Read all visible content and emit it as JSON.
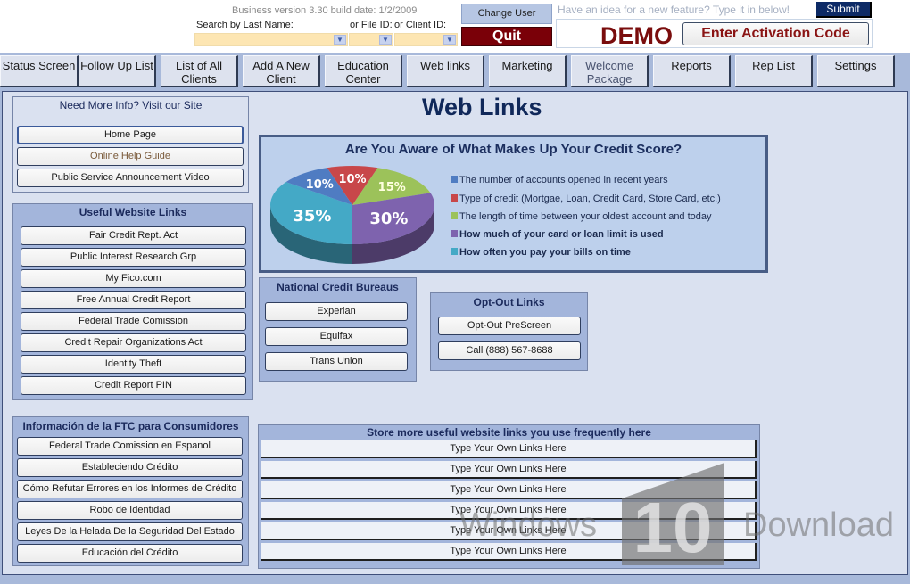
{
  "header": {
    "version_text": "Business version 3.30  build date: 1/2/2009",
    "search_last_name_label": "Search by Last Name:",
    "file_id_label": "or File ID:",
    "client_id_label": "or Client ID:",
    "search_last_name_value": "",
    "file_id_value": "",
    "client_id_value": "",
    "change_user_label": "Change User",
    "quit_label": "Quit",
    "feature_idea_placeholder": "Have an idea for a new feature? Type it in below!",
    "submit_label": "Submit",
    "demo_label": "DEMO",
    "activation_label": "Enter Activation Code"
  },
  "nav": {
    "items": [
      {
        "label": "Status Screen"
      },
      {
        "label": "Follow Up List"
      },
      {
        "label": "List of All Clients"
      },
      {
        "label": "Add A New Client"
      },
      {
        "label": "Education Center"
      },
      {
        "label": "Web links"
      },
      {
        "label": "Marketing"
      },
      {
        "label": "Welcome Package"
      },
      {
        "label": "Reports"
      },
      {
        "label": "Rep List"
      },
      {
        "label": "Settings"
      }
    ]
  },
  "page": {
    "title": "Web Links"
  },
  "site_group": {
    "title": "Need More Info? Visit our Site",
    "buttons": [
      "Home Page",
      "Online Help Guide",
      "Public Service Announcement Video"
    ]
  },
  "useful_group": {
    "title": "Useful Website Links",
    "buttons": [
      "Fair Credit Rept. Act",
      "Public Interest Research Grp",
      "My Fico.com",
      "Free Annual Credit Report",
      "Federal Trade Comission",
      "Credit Repair Organizations Act",
      "Identity Theft",
      "Credit Report PIN"
    ]
  },
  "ftc_group": {
    "title": "Información de la FTC para Consumidores",
    "buttons": [
      "Federal Trade Comission en Espanol",
      "Estableciendo Crédito",
      "Cómo Refutar Errores en los Informes de Crédito",
      "Robo de Identidad",
      "Leyes De la Helada De la Seguridad Del Estado",
      "Educación del Crédito"
    ]
  },
  "bureaus_group": {
    "title": "National Credit Bureaus",
    "buttons": [
      "Experian",
      "Equifax",
      "Trans Union"
    ]
  },
  "optout_group": {
    "title": "Opt-Out Links",
    "buttons": [
      "Opt-Out PreScreen",
      "Call (888) 567-8688"
    ]
  },
  "own_links_group": {
    "title": "Store more useful website links you use frequently here",
    "buttons": [
      "Type Your Own Links Here",
      "Type Your Own Links Here",
      "Type Your Own Links Here",
      "Type Your Own Links Here",
      "Type Your Own Links Here",
      "Type Your Own Links Here"
    ]
  },
  "chart_data": {
    "type": "pie",
    "title": "Are You Aware of What Makes Up Your Credit Score?",
    "categories": [
      "The number of accounts opened in recent years",
      "Type of credit (Mortgae, Loan, Credit Card, Store Card, etc.)",
      "The length of time between your oldest account and today",
      "How much of your card or loan limit is used",
      "How often you pay your bills on time"
    ],
    "values": [
      10,
      10,
      15,
      30,
      35
    ],
    "labels": [
      "10%",
      "10%",
      "15%",
      "30%",
      "35%"
    ],
    "colors": [
      "#4f7cc2",
      "#c8474a",
      "#9cc25a",
      "#7e63ae",
      "#44a9c6"
    ],
    "legend_position": "right"
  },
  "watermark": {
    "left_text": "Windows",
    "right_text": "Download",
    "logo_text": "10"
  }
}
